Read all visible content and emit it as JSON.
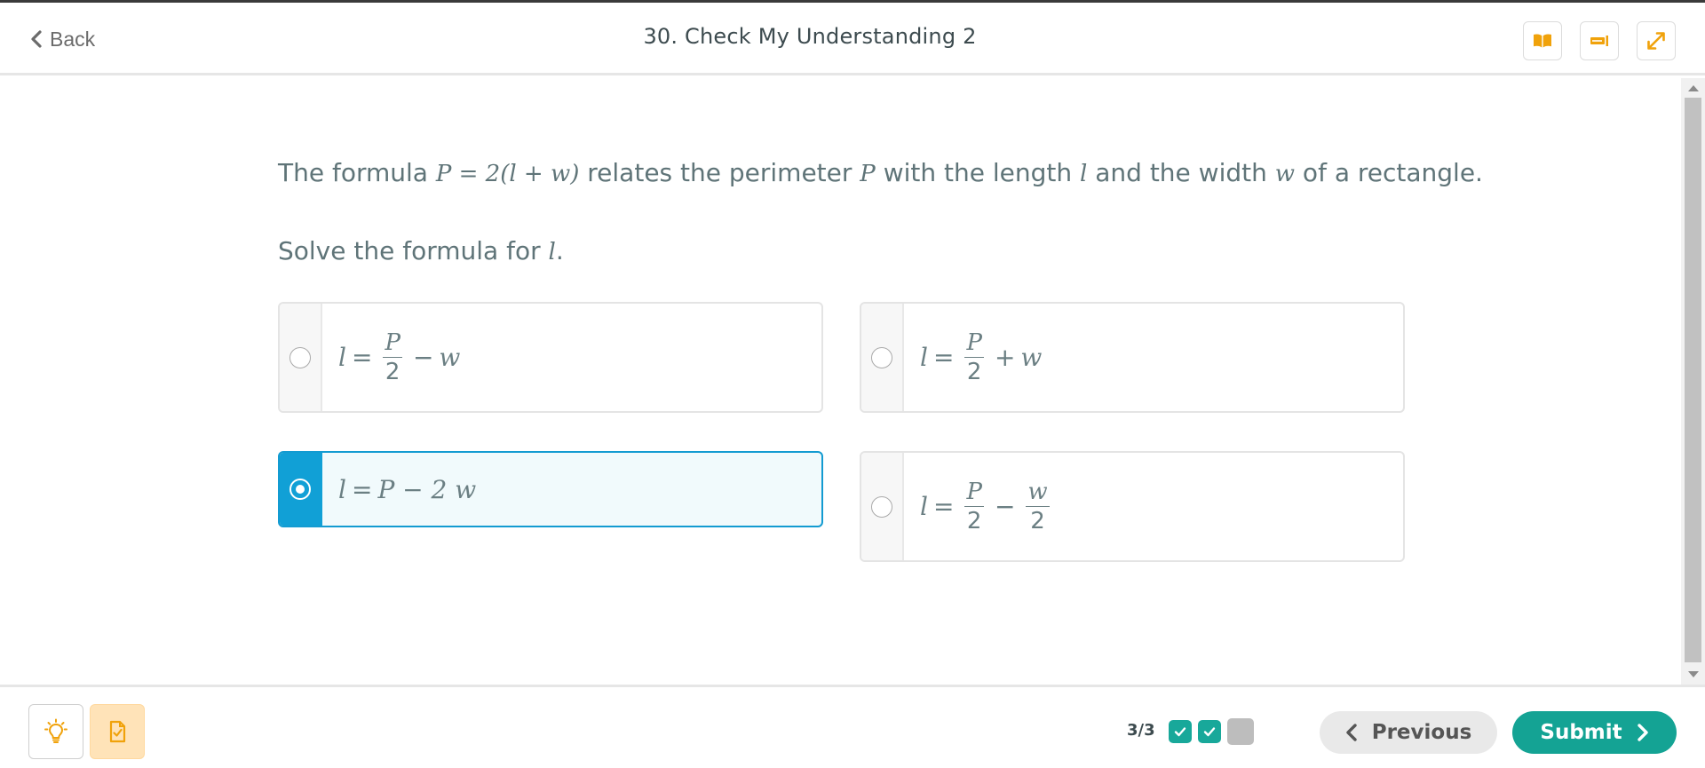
{
  "header": {
    "back_label": "Back",
    "title": "30. Check My Understanding 2",
    "buttons": [
      "book-icon",
      "glossary-icon",
      "expand-icon"
    ]
  },
  "question": {
    "text_1": "The formula ",
    "formula": "P = 2(l + w)",
    "text_2": " relates the perimeter ",
    "var_p": "P",
    "text_3": " with the length ",
    "var_l": "l",
    "text_4": " and the width ",
    "var_w": "w",
    "text_5": " of a rectangle.",
    "solve_prefix": "Solve the formula for ",
    "solve_var": "l",
    "solve_suffix": "."
  },
  "choices": [
    {
      "lhs": "l",
      "eq": "=",
      "num": "P",
      "den": "2",
      "op": "−",
      "rest": "w",
      "selected": false
    },
    {
      "lhs": "l",
      "eq": "=",
      "num": "P",
      "den": "2",
      "op": "+",
      "rest": "w",
      "selected": false
    },
    {
      "lhs": "l",
      "eq": "=",
      "expr": "P − 2 w",
      "selected": true
    },
    {
      "lhs": "l",
      "eq": "=",
      "num": "P",
      "den": "2",
      "op": "−",
      "num2": "w",
      "den2": "2",
      "selected": false
    }
  ],
  "footer": {
    "progress": "3/3",
    "previous_label": "Previous",
    "submit_label": "Submit",
    "steps": [
      "done",
      "done",
      "todo"
    ]
  },
  "colors": {
    "accent_blue": "#11a0d6",
    "accent_teal": "#14a394",
    "notes_orange": "#ffe3b8",
    "icon_orange": "#f0a20b"
  }
}
